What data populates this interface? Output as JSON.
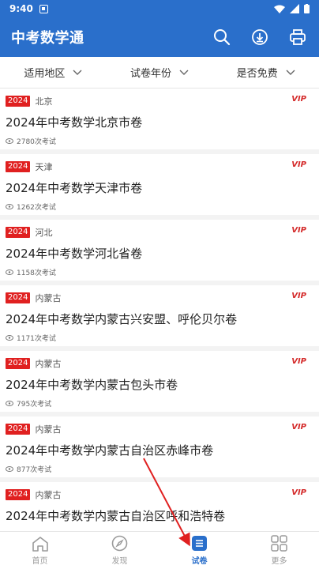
{
  "status": {
    "time": "9:40"
  },
  "appbar": {
    "title": "中考数学通"
  },
  "filters": [
    {
      "label": "适用地区"
    },
    {
      "label": "试卷年份"
    },
    {
      "label": "是否免费"
    }
  ],
  "items": [
    {
      "year": "2024",
      "region": "北京",
      "vip": "VIP",
      "title": "2024年中考数学北京市卷",
      "views": "2780次考试"
    },
    {
      "year": "2024",
      "region": "天津",
      "vip": "VIP",
      "title": "2024年中考数学天津市卷",
      "views": "1262次考试"
    },
    {
      "year": "2024",
      "region": "河北",
      "vip": "VIP",
      "title": "2024年中考数学河北省卷",
      "views": "1158次考试"
    },
    {
      "year": "2024",
      "region": "内蒙古",
      "vip": "VIP",
      "title": "2024年中考数学内蒙古兴安盟、呼伦贝尔卷",
      "views": "1171次考试"
    },
    {
      "year": "2024",
      "region": "内蒙古",
      "vip": "VIP",
      "title": "2024年中考数学内蒙古包头市卷",
      "views": "795次考试"
    },
    {
      "year": "2024",
      "region": "内蒙古",
      "vip": "VIP",
      "title": "2024年中考数学内蒙古自治区赤峰市卷",
      "views": "877次考试"
    },
    {
      "year": "2024",
      "region": "内蒙古",
      "vip": "VIP",
      "title": "2024年中考数学内蒙古自治区呼和浩特卷",
      "views": ""
    }
  ],
  "tabs": [
    {
      "label": "首页",
      "icon": "home-icon"
    },
    {
      "label": "发现",
      "icon": "compass-icon"
    },
    {
      "label": "试卷",
      "icon": "list-icon",
      "active": true
    },
    {
      "label": "更多",
      "icon": "grid-icon"
    }
  ],
  "colors": {
    "primary": "#2a6fcb",
    "badge": "#e02020",
    "vip": "#d42a2a"
  }
}
